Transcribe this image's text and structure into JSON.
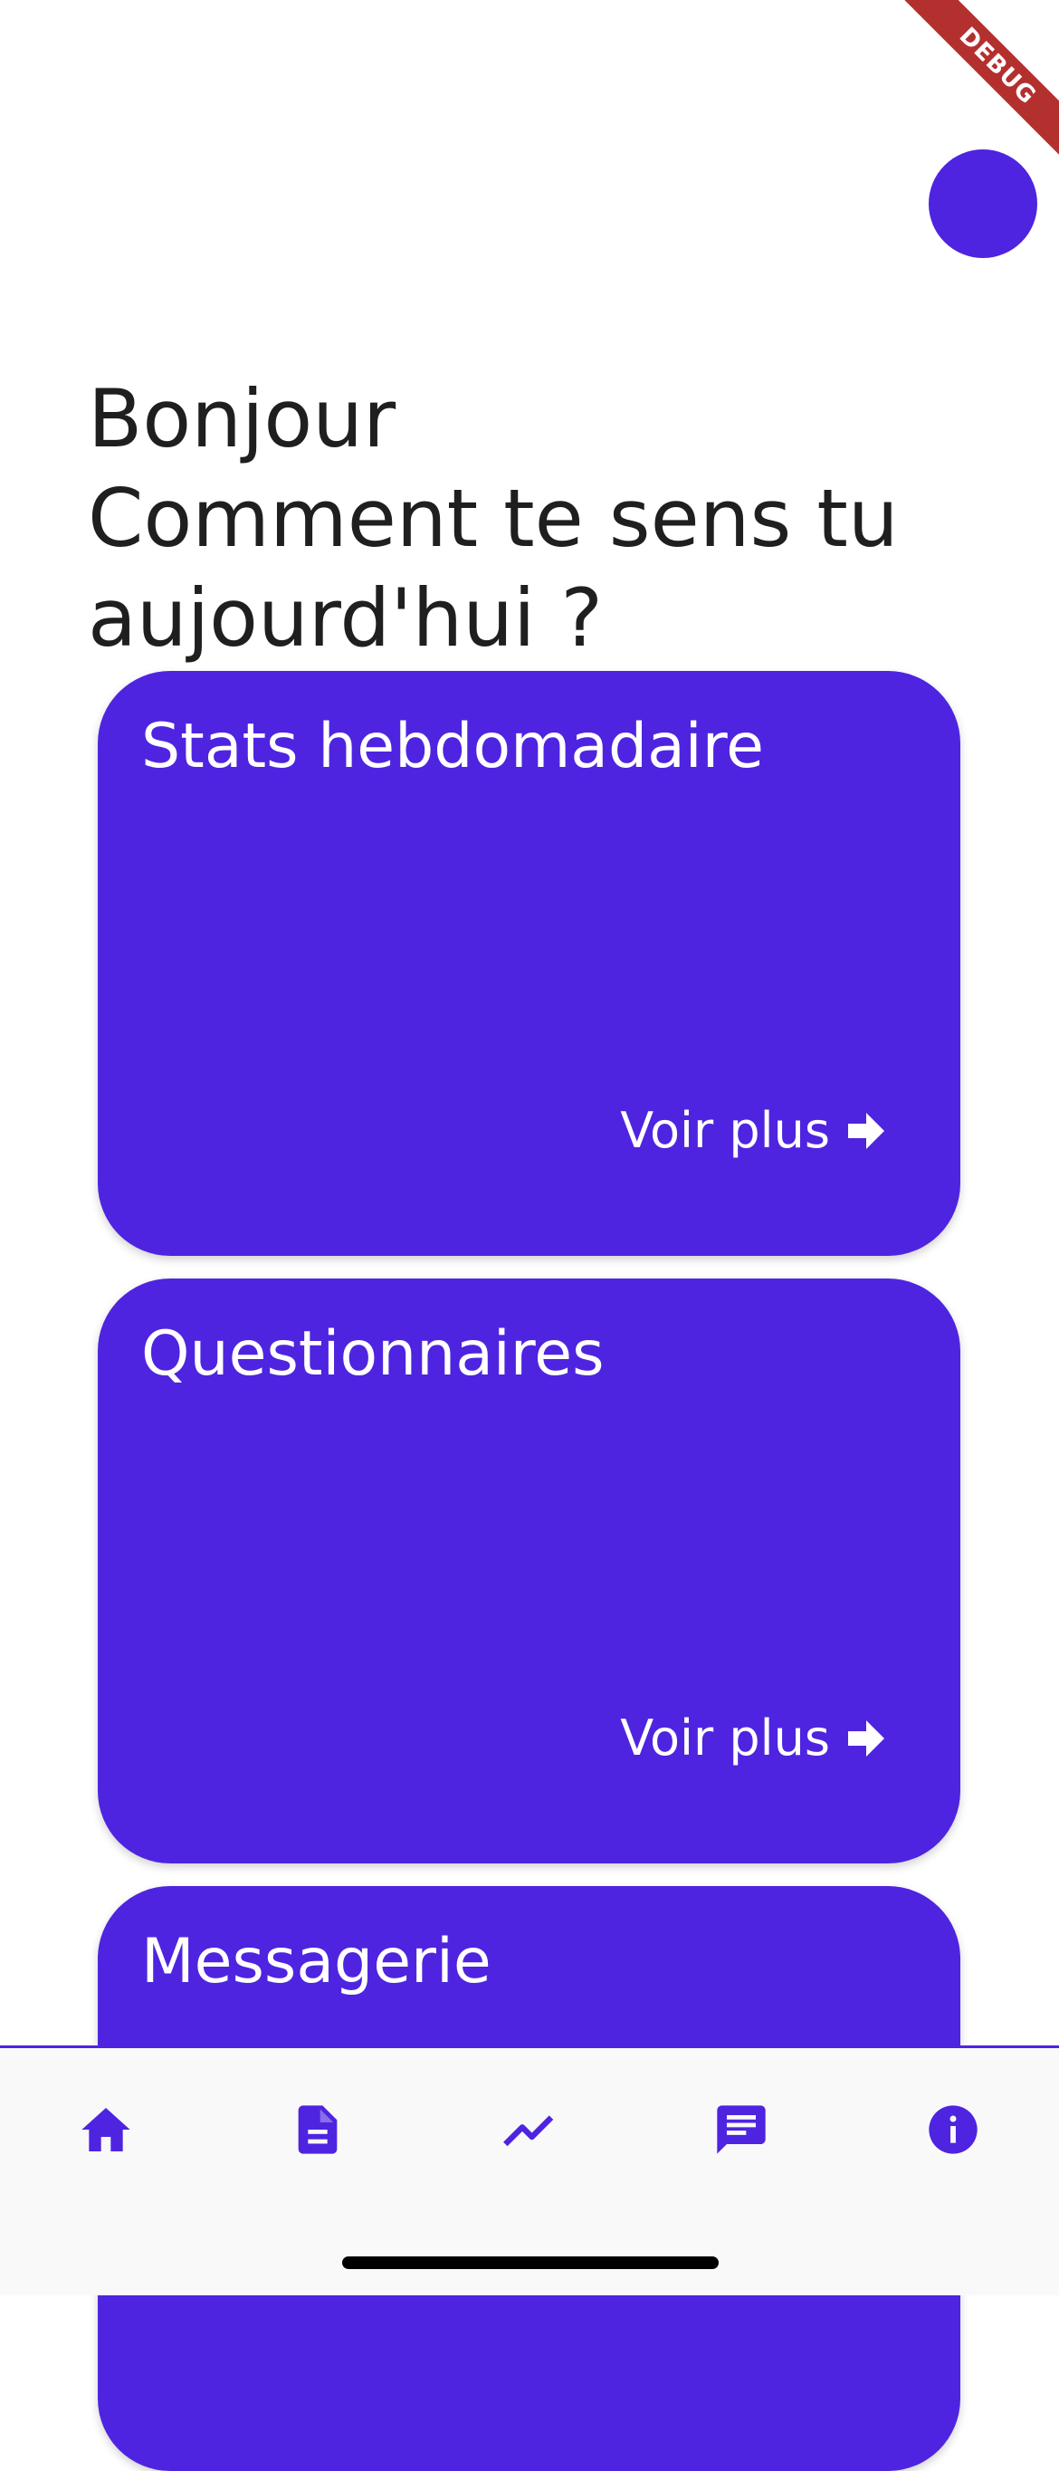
{
  "debug_label": "DEBUG",
  "greeting": {
    "line1": "Bonjour",
    "line2": "Comment te sens tu",
    "line3": "aujourd'hui ?"
  },
  "cards": [
    {
      "title": "Stats hebdomadaire",
      "more_label": "Voir plus"
    },
    {
      "title": "Questionnaires",
      "more_label": "Voir plus"
    },
    {
      "title": "Messagerie"
    }
  ],
  "bottom_nav": {
    "items": [
      {
        "icon": "home-icon"
      },
      {
        "icon": "document-icon"
      },
      {
        "icon": "trending-icon"
      },
      {
        "icon": "chat-icon"
      },
      {
        "icon": "info-icon"
      }
    ]
  },
  "colors": {
    "primary": "#4e24e0",
    "debug_ribbon": "#b3302f",
    "nav_background": "#f9f9f9"
  }
}
